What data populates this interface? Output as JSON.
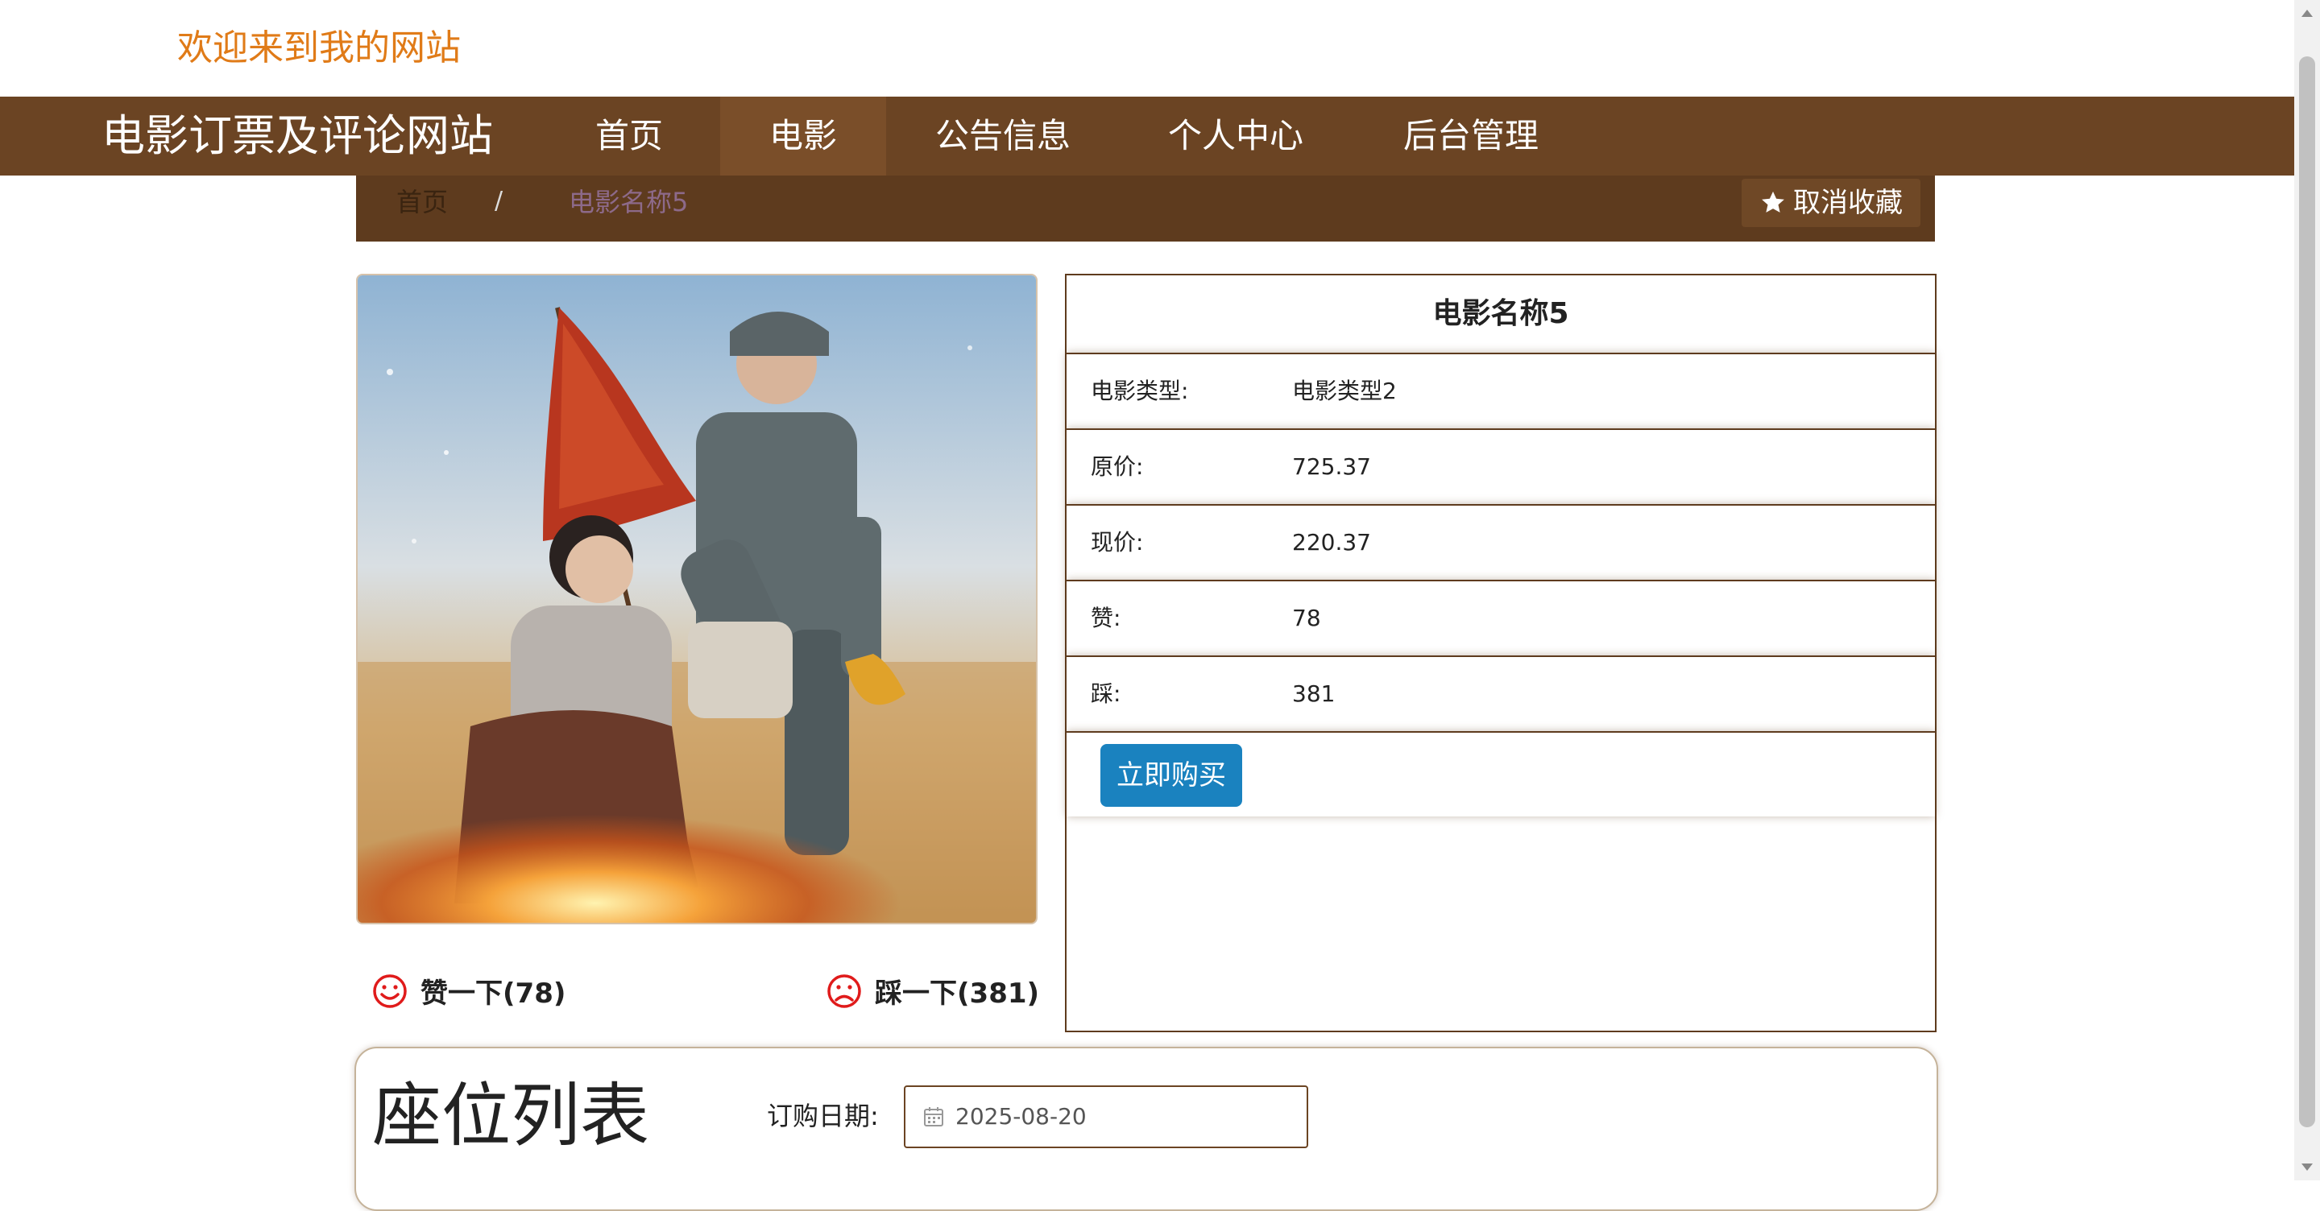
{
  "header": {
    "welcome": "欢迎来到我的网站"
  },
  "nav": {
    "brand": "电影订票及评论网站",
    "items": [
      {
        "label": "首页"
      },
      {
        "label": "电影",
        "active": true
      },
      {
        "label": "公告信息"
      },
      {
        "label": "个人中心"
      },
      {
        "label": "后台管理"
      }
    ]
  },
  "breadcrumb": {
    "home": "首页",
    "separator": "/",
    "current": "电影名称5"
  },
  "favorite_button": {
    "icon": "star-icon",
    "label": "取消收藏"
  },
  "poster": {
    "alt": "电影海报"
  },
  "votes": {
    "like": {
      "icon": "smile-icon",
      "label": "赞一下(78)"
    },
    "dislike": {
      "icon": "frown-icon",
      "label": "踩一下(381)"
    }
  },
  "details": {
    "title": "电影名称5",
    "rows": [
      {
        "label": "电影类型:",
        "value": "电影类型2"
      },
      {
        "label": "原价:",
        "value": "725.37"
      },
      {
        "label": "现价:",
        "value": "220.37"
      },
      {
        "label": "赞:",
        "value": "78"
      },
      {
        "label": "踩:",
        "value": "381"
      }
    ],
    "buy_label": "立即购买"
  },
  "seats": {
    "title": "座位列表",
    "date_label": "订购日期:",
    "date_value": "2025-08-20",
    "date_icon": "calendar-icon"
  },
  "colors": {
    "nav_bg": "#6b4423",
    "accent": "#e07b18",
    "buy_button": "#1a82bf",
    "vote_icon": "#e01b1b"
  }
}
